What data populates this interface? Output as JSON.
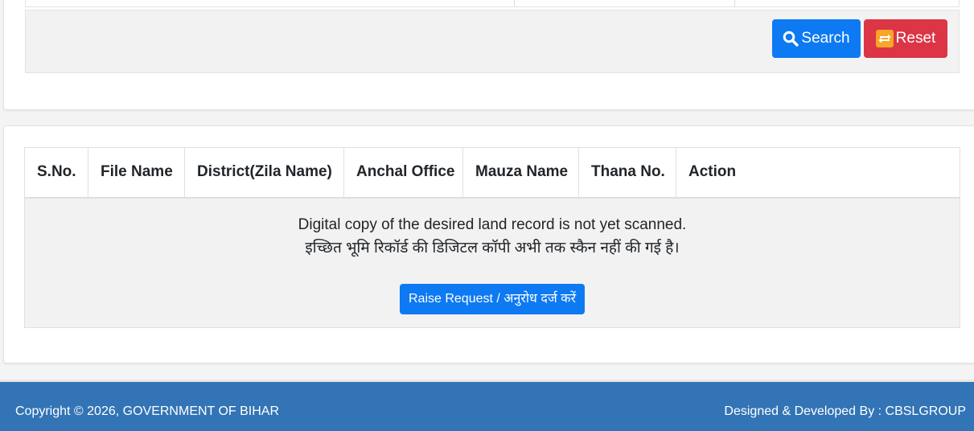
{
  "search_panel": {
    "search_label": "Search",
    "reset_label": "Reset"
  },
  "results_table": {
    "columns": [
      "S.No.",
      "File Name",
      "District(Zila Name)",
      "Anchal Office",
      "Mauza Name",
      "Thana No.",
      "Action"
    ],
    "empty_message_en": "Digital copy of the desired land record is not yet scanned.",
    "empty_message_hi": "इच्छित भूमि रिकॉर्ड की डिजिटल कॉपी अभी तक स्कैन नहीं की गई है।",
    "raise_request_label": "Raise Request / अनुरोध दर्ज करें"
  },
  "footer": {
    "copyright": "Copyright © 2026, GOVERNMENT OF BIHAR",
    "credits": "Designed & Developed By : CBSLGROUP"
  },
  "colors": {
    "primary": "#0d7af3",
    "danger": "#dc3545",
    "footer_bg": "#3274b5",
    "reset_icon": "#f7a625"
  },
  "icons": {
    "search": "search-icon",
    "reset": "refresh-icon"
  }
}
